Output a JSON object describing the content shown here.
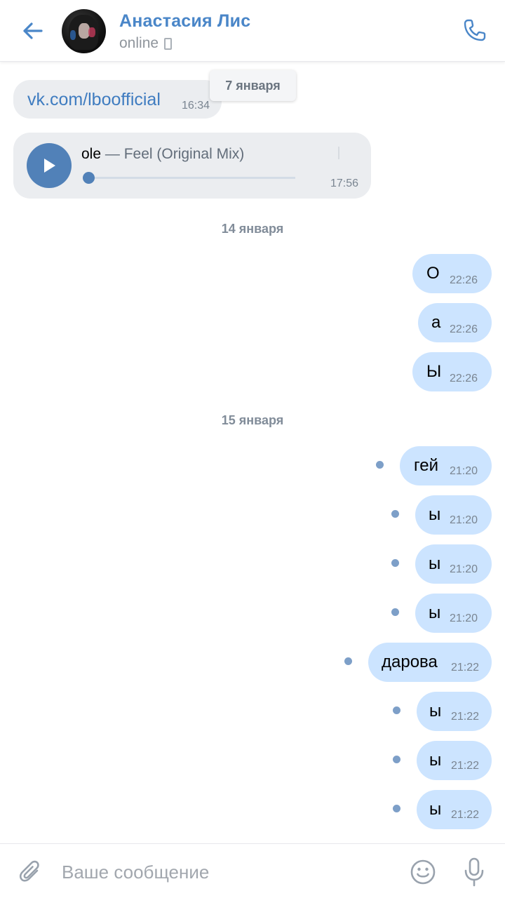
{
  "header": {
    "contact_name": "Анастасия Лис",
    "status": "online",
    "accent_color": "#4a86c8",
    "icons": {
      "back": "arrow-left-icon",
      "call": "phone-icon",
      "device": "mobile-icon"
    }
  },
  "floating_date": "7 января",
  "incoming": {
    "link_message": {
      "text": "vk.com/lboofficial",
      "time": "16:34"
    },
    "audio_message": {
      "artist_visible": "ole",
      "separator": " — ",
      "title": "Feel (Original Mix)",
      "time": "17:56",
      "progress": 0.0
    }
  },
  "dates": {
    "d14": "14 января",
    "d15": "15 января"
  },
  "outgoing": [
    {
      "text": "О",
      "time": "22:26",
      "unread": false
    },
    {
      "text": "а",
      "time": "22:26",
      "unread": false
    },
    {
      "text": "Ы",
      "time": "22:26",
      "unread": false
    },
    {
      "text": "гей",
      "time": "21:20",
      "unread": true
    },
    {
      "text": "ы",
      "time": "21:20",
      "unread": true
    },
    {
      "text": "ы",
      "time": "21:20",
      "unread": true
    },
    {
      "text": "ы",
      "time": "21:20",
      "unread": true
    },
    {
      "text": "дарова",
      "time": "21:22",
      "unread": true
    },
    {
      "text": "ы",
      "time": "21:22",
      "unread": true
    },
    {
      "text": "ы",
      "time": "21:22",
      "unread": true
    },
    {
      "text": "ы",
      "time": "21:22",
      "unread": true
    }
  ],
  "composer": {
    "placeholder": "Ваше сообщение",
    "value": "",
    "icons": {
      "attach": "paperclip-icon",
      "emoji": "smile-icon",
      "mic": "microphone-icon"
    }
  },
  "colors": {
    "outgoing_bubble": "#cce4ff",
    "incoming_bubble": "#ebedf0",
    "unread_dot": "#7d9fc8"
  }
}
